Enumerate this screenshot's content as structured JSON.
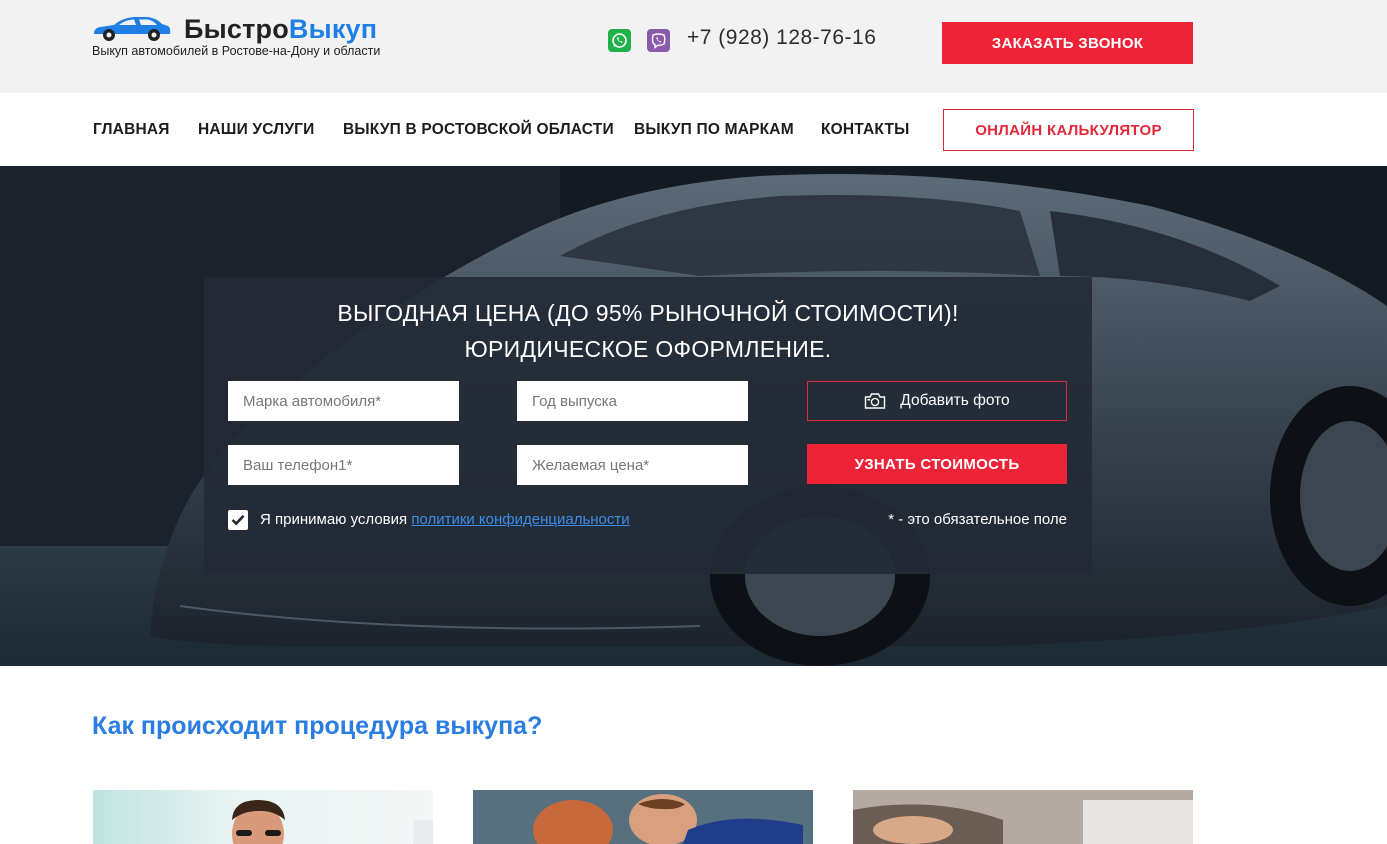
{
  "header": {
    "logo_part1": "Быстро",
    "logo_part2": "Выкуп",
    "tagline": "Выкуп автомобилей в Ростове-на-Дону и области",
    "phone": "+7 (928) 128-76-16",
    "call_button": "ЗАКАЗАТЬ ЗВОНОК",
    "messengers": [
      "whatsapp-icon",
      "viber-icon"
    ]
  },
  "nav": {
    "items": [
      {
        "label": "ГЛАВНАЯ"
      },
      {
        "label": "НАШИ УСЛУГИ"
      },
      {
        "label": "ВЫКУП В РОСТОВСКОЙ ОБЛАСТИ"
      },
      {
        "label": "ВЫКУП ПО МАРКАМ"
      },
      {
        "label": "КОНТАКТЫ"
      }
    ],
    "calc_button": "ОНЛАЙН КАЛЬКУЛЯТОР"
  },
  "hero": {
    "title_line1": "ВЫГОДНАЯ ЦЕНА (ДО 95% РЫНОЧНОЙ СТОИМОСТИ)!",
    "title_line2": "ЮРИДИЧЕСКОЕ ОФОРМЛЕНИЕ.",
    "form": {
      "brand_placeholder": "Марка автомобиля*",
      "year_placeholder": "Год выпуска",
      "phone_placeholder": "Ваш телефон1*",
      "price_placeholder": "Желаемая цена*",
      "photo_button": "Добавить фото",
      "submit_button": "УЗНАТЬ СТОИМОСТЬ",
      "agree_text": "Я принимаю условия ",
      "agree_link": "политики конфиденциальности",
      "agree_checked": true,
      "required_note": "* - это обязательное поле"
    }
  },
  "section": {
    "title": "Как происходит процедура выкупа?"
  },
  "colors": {
    "accent_red": "#ef2337",
    "brand_blue": "#1f7fe5",
    "panel_bg": "#232a36"
  }
}
